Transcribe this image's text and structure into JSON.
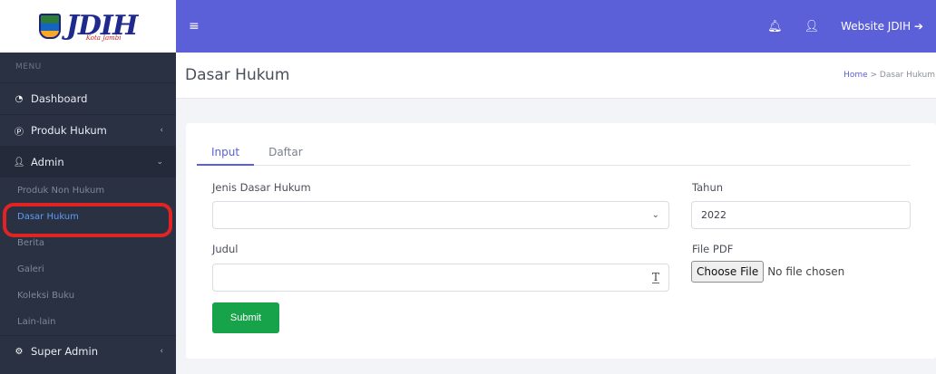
{
  "logo": {
    "text": "JDIH",
    "subtext": "Kota Jambi"
  },
  "sidebar": {
    "menu_title": "MENU",
    "items": [
      {
        "label": "Dashboard",
        "icon": "dashboard-icon"
      },
      {
        "label": "Produk Hukum",
        "icon": "p-circle-icon",
        "chevron": "‹"
      },
      {
        "label": "Admin",
        "icon": "user-icon",
        "chevron": "⌄"
      }
    ],
    "admin_sub": [
      "Produk Non Hukum",
      "Dasar Hukum",
      "Berita",
      "Galeri",
      "Koleksi Buku",
      "Lain-lain"
    ],
    "super_admin": {
      "label": "Super Admin",
      "icon": "gear-icon",
      "chevron": "‹"
    }
  },
  "topbar": {
    "menu_glyph": "≡",
    "bell": "🔔︎",
    "user": "👤︎",
    "link": "Website JDIH ➔"
  },
  "header": {
    "title": "Dasar Hukum",
    "crumb_home": "Home",
    "crumb_sep": " > ",
    "crumb_current": "Dasar Hukum"
  },
  "tabs": [
    "Input",
    "Daftar"
  ],
  "form": {
    "jenis_label": "Jenis Dasar Hukum",
    "jenis_value": "",
    "tahun_label": "Tahun",
    "tahun_value": "2022",
    "judul_label": "Judul",
    "judul_value": "",
    "file_label": "File PDF",
    "file_button": "Choose File",
    "file_status": "No file chosen",
    "submit": "Submit"
  },
  "colors": {
    "accent": "#5b5fd8",
    "sidebar": "#2a3142",
    "submit": "#16a34a",
    "highlight": "#e02424"
  }
}
